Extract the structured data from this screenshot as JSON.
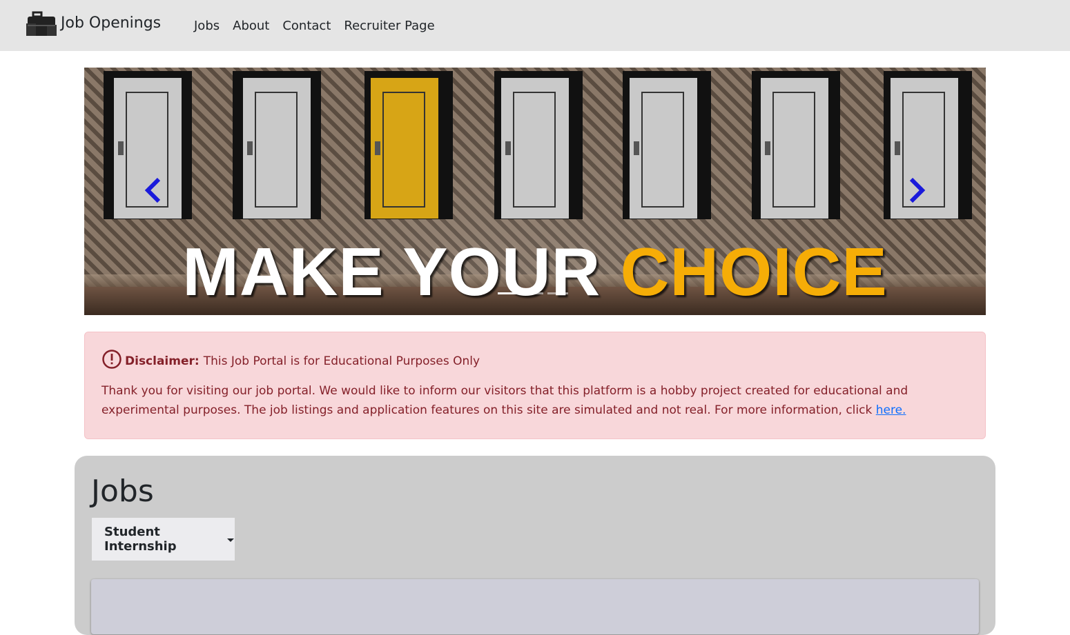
{
  "navbar": {
    "brand": "Job Openings",
    "brand_icon": "briefcase-icon",
    "links": [
      "Jobs",
      "About",
      "Contact",
      "Recruiter Page"
    ]
  },
  "carousel": {
    "headline_white": "MAKE YOUR",
    "headline_accent": "CHOICE",
    "accent_color": "#f6ad07",
    "control_color": "#1a1adb",
    "slide_count": 3,
    "active_slide": 1
  },
  "alert": {
    "title_bold": "Disclaimer:",
    "title_rest": "This Job Portal is for Educational Purposes Only",
    "body": "Thank you for visiting our job portal. We would like to inform our visitors that this platform is a hobby project created for educational and experimental purposes. The job listings and application features on this site are simulated and not real. For more information, click ",
    "link_text": "here."
  },
  "jobs": {
    "title": "Jobs",
    "filter_selected": "Student Internship"
  }
}
